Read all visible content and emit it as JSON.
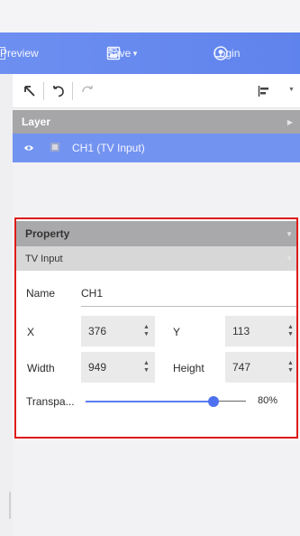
{
  "header": {
    "preview_label": "Preview",
    "save_label": "Save",
    "login_label": "Login"
  },
  "layer_panel": {
    "title": "Layer",
    "items": [
      {
        "name": "CH1 (TV Input)"
      }
    ]
  },
  "property_panel": {
    "title": "Property",
    "section": "TV Input",
    "name_label": "Name",
    "name_value": "CH1",
    "x_label": "X",
    "x_value": "376",
    "y_label": "Y",
    "y_value": "113",
    "width_label": "Width",
    "width_value": "949",
    "height_label": "Height",
    "height_value": "747",
    "transparency_label": "Transpa...",
    "transparency_value": "80%",
    "transparency_fraction": 0.8
  },
  "colors": {
    "header_accent": "#6d8ff1",
    "layer_selected": "#7393f1",
    "highlight_frame": "#e01a1a",
    "slider": "#4e72ef"
  },
  "icons": {
    "preview": "preview-icon",
    "save": "save-icon",
    "dropdown": "chevron-down-icon",
    "login": "user-circle-icon",
    "select": "cursor-icon",
    "undo": "undo-icon",
    "redo": "redo-icon",
    "align": "align-left-icon",
    "visibility": "eye-icon"
  }
}
